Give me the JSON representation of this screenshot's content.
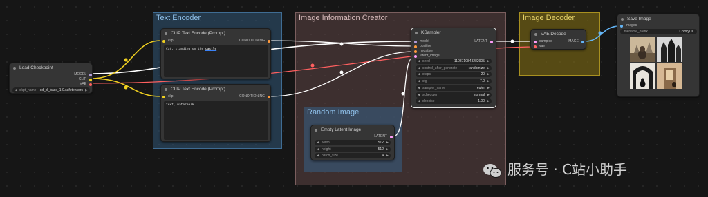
{
  "groups": {
    "text_encoder": "Text Encoder",
    "image_info": "Image Information Creator",
    "random_image": "Random Image",
    "image_decoder": "Image Decoder"
  },
  "load_checkpoint": {
    "title": "Load Checkpoint",
    "outputs": [
      "MODEL",
      "CLIP",
      "VAE"
    ],
    "widget_label": "ckpt_name",
    "widget_value": "sd_xl_base_1.0.safetensors"
  },
  "clip_pos": {
    "title": "CLIP Text Encode (Prompt)",
    "input": "clip",
    "output": "CONDITIONING",
    "text_prefix": "Cat, standing on the ",
    "text_highlight": "castle"
  },
  "clip_neg": {
    "title": "CLIP Text Encode (Prompt)",
    "input": "clip",
    "output": "CONDITIONING",
    "text": "text, watermark"
  },
  "ksampler": {
    "title": "KSampler",
    "inputs": [
      "model",
      "positive",
      "negative",
      "latent_image"
    ],
    "output": "LATENT",
    "widgets": [
      {
        "label": "seed",
        "value": "1108710843282905"
      },
      {
        "label": "control_after_generate",
        "value": "randomize"
      },
      {
        "label": "steps",
        "value": "20"
      },
      {
        "label": "cfg",
        "value": "7.0"
      },
      {
        "label": "sampler_name",
        "value": "euler"
      },
      {
        "label": "scheduler",
        "value": "normal"
      },
      {
        "label": "denoise",
        "value": "1.00"
      }
    ]
  },
  "empty_latent": {
    "title": "Empty Latent Image",
    "output": "LATENT",
    "widgets": [
      {
        "label": "width",
        "value": "512"
      },
      {
        "label": "height",
        "value": "512"
      },
      {
        "label": "batch_size",
        "value": "4"
      }
    ]
  },
  "vae_decode": {
    "title": "VAE Decode",
    "inputs": [
      "samples",
      "vae"
    ],
    "output": "IMAGE"
  },
  "save_image": {
    "title": "Save Image",
    "input": "images",
    "widget_label": "filename_prefix",
    "widget_value": "ComfyUI"
  },
  "watermark": "服务号 · C站小助手",
  "colors": {
    "clip": "#f0d020",
    "model": "#ffffff",
    "vae": "#ff6060",
    "cond": "#ff9a3c",
    "latent": "#ff9cf9",
    "image": "#64b5f6"
  }
}
